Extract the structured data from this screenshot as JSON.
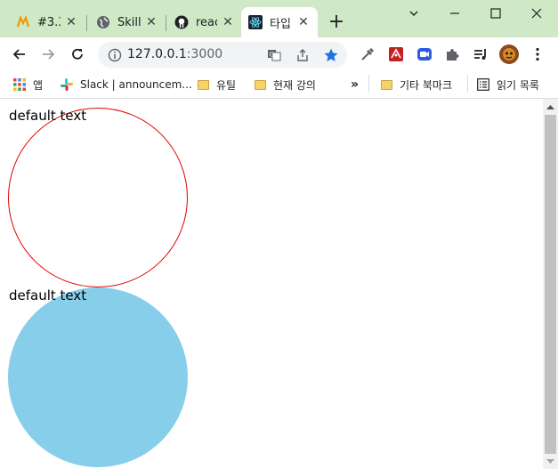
{
  "tabs": [
    {
      "title": "#3.3",
      "icon": "mosaic-logo-icon",
      "active": false
    },
    {
      "title": "Skill",
      "icon": "globe-icon",
      "active": false
    },
    {
      "title": "reac",
      "icon": "github-icon",
      "active": false
    },
    {
      "title": "타입",
      "icon": "react-icon",
      "active": true
    }
  ],
  "address": {
    "host": "127.0.0.1",
    "port": ":3000"
  },
  "bookmarks": [
    {
      "label": "앱",
      "icon": "apps-grid-icon"
    },
    {
      "label": "Slack | announcem...",
      "icon": "slack-icon"
    },
    {
      "label": "유틸",
      "icon": "folder-icon"
    },
    {
      "label": "현재 강의",
      "icon": "folder-icon"
    },
    {
      "label": "»",
      "icon": "more-bookmarks-icon"
    },
    {
      "label": "기타 북마크",
      "icon": "folder-icon"
    },
    {
      "label": "읽기 목록",
      "icon": "reading-list-icon"
    }
  ],
  "content": {
    "circles": [
      {
        "text": "default text",
        "fill": "#ffffff",
        "border": "#e00000"
      },
      {
        "text": "default text",
        "fill": "#87ceeb",
        "border": "none"
      }
    ]
  },
  "colors": {
    "titlebar": "#cfe8c5",
    "star": "#1a73e8"
  }
}
